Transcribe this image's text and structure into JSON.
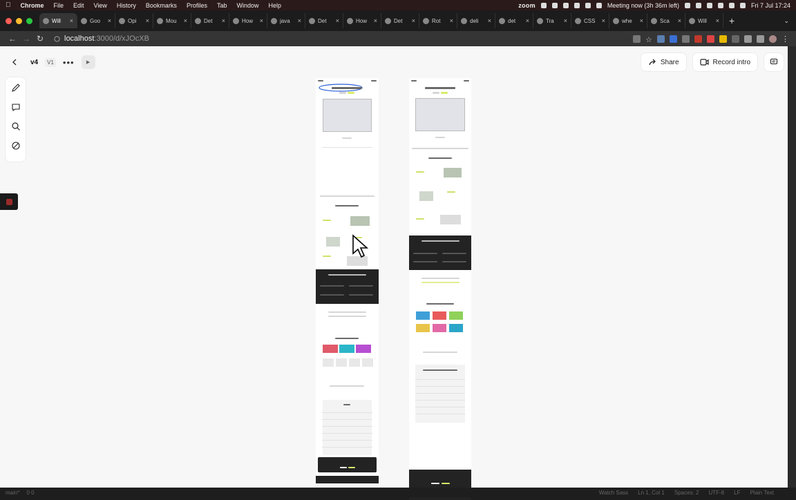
{
  "menubar": {
    "app_name": "Chrome",
    "menus": [
      "File",
      "Edit",
      "View",
      "History",
      "Bookmarks",
      "Profiles",
      "Tab",
      "Window",
      "Help"
    ],
    "zoom_label": "zoom",
    "meeting": "Meeting now (3h 36m left)",
    "datetime": "Fri 7 Jul  17:24"
  },
  "tabs": [
    {
      "label": "Will",
      "active": true
    },
    {
      "label": "Goo"
    },
    {
      "label": "Opi"
    },
    {
      "label": "Mou"
    },
    {
      "label": "Det"
    },
    {
      "label": "How"
    },
    {
      "label": "java"
    },
    {
      "label": "Det"
    },
    {
      "label": "How"
    },
    {
      "label": "Det"
    },
    {
      "label": "Rot"
    },
    {
      "label": "deli"
    },
    {
      "label": "det"
    },
    {
      "label": "Tra"
    },
    {
      "label": "CSS"
    },
    {
      "label": "whe"
    },
    {
      "label": "Sca"
    },
    {
      "label": "Will"
    }
  ],
  "address": {
    "host": "localhost",
    "path": ":3000/d/xJOcXB"
  },
  "toolbar": {
    "version": "v4",
    "version_badge": "V1",
    "more": "•••",
    "play": "▶",
    "share_label": "Share",
    "record_label": "Record intro"
  },
  "status": {
    "branch": "main*",
    "problems": "0  0",
    "items": [
      "Watch Sass",
      "Ln 1, Col 1",
      "Spaces: 2",
      "UTF-8",
      "LF",
      "Plain Text"
    ]
  }
}
